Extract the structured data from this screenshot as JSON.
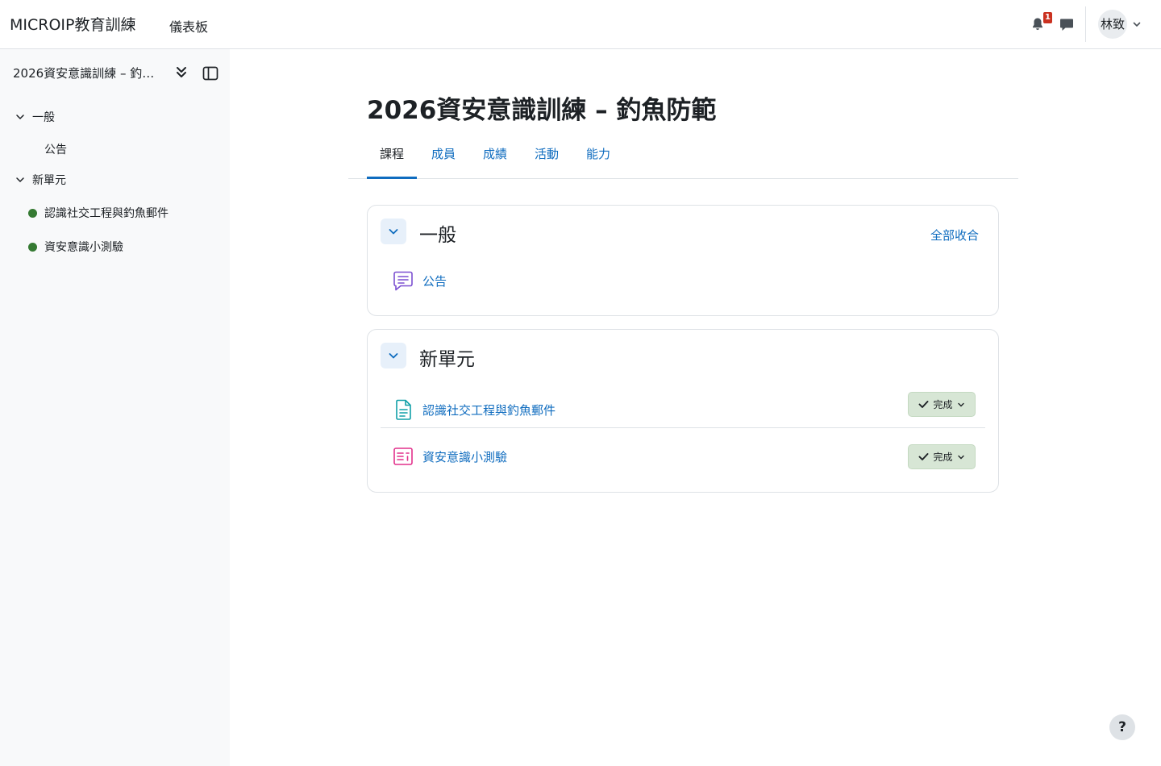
{
  "navbar": {
    "brand": "MICROIP教育訓練",
    "dashboard_label": "儀表板",
    "notification_count": "1",
    "user_name": "林致"
  },
  "drawer": {
    "course_title": "2026資安意識訓練 – 釣魚防範",
    "sections": [
      {
        "label": "一般",
        "items": [
          {
            "label": "公告"
          }
        ]
      },
      {
        "label": "新單元",
        "items": [
          {
            "label": "認識社交工程與釣魚郵件"
          },
          {
            "label": "資安意識小測驗"
          }
        ]
      }
    ]
  },
  "main": {
    "title": "2026資安意識訓練 – 釣魚防範",
    "tabs": [
      {
        "label": "課程",
        "active": true
      },
      {
        "label": "成員"
      },
      {
        "label": "成績"
      },
      {
        "label": "活動"
      },
      {
        "label": "能力"
      }
    ],
    "collapse_all_label": "全部收合",
    "sections": [
      {
        "title": "一般",
        "activities": [
          {
            "label": "公告",
            "icon": "forum-icon"
          }
        ]
      },
      {
        "title": "新單元",
        "activities": [
          {
            "label": "認識社交工程與釣魚郵件",
            "icon": "page-icon",
            "completion": "完成"
          },
          {
            "label": "資安意識小測驗",
            "icon": "quiz-icon",
            "completion": "完成"
          }
        ]
      }
    ]
  },
  "help": {
    "label": "?"
  },
  "colors": {
    "link": "#0f6cbf",
    "completion_bg": "#d7e6d5",
    "completed_dot": "#357a32",
    "badge": "#ca3120"
  }
}
